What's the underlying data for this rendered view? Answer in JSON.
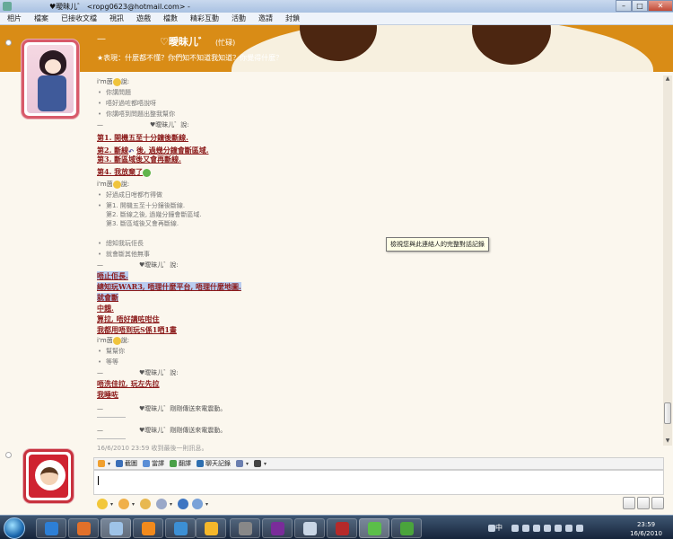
{
  "window": {
    "title": "♥曖昧儿゛ <ropg0623@hotmail.com> - ",
    "controls": {
      "minimize": "–",
      "maximize": "□",
      "close": "✕"
    }
  },
  "menu": [
    "相片",
    "檔案",
    "已接收文檔",
    "視訊",
    "遊戲",
    "檔數",
    "精彩互動",
    "活動",
    "邀請",
    "封鎖"
  ],
  "contact": {
    "dash": "—",
    "name": "♡曖昧儿゛",
    "state": "(忙碌)",
    "personal_message": "★表現：什麼都不懂？你們知不知道我知道？你覺得什麼？"
  },
  "tooltip": "檢視您與此連絡人的完整對話記錄",
  "timestamp": "16/6/2010 23:59 收到最後一則訊息。",
  "conversation": [
    {
      "kind": "speaker",
      "text": "i'm茵",
      "suffix": "說:",
      "emo": "star"
    },
    {
      "kind": "line",
      "text": "你講問題"
    },
    {
      "kind": "line",
      "text": "唔好過咗都唔說呀"
    },
    {
      "kind": "line",
      "text": "你講唔到問題出整我幫你"
    },
    {
      "kind": "quote",
      "text": "♥曖昧儿゛說:"
    },
    {
      "kind": "red",
      "text": "第1. 開機五至十分鐘後斷線."
    },
    {
      "kind": "red",
      "text": "第2. 斷線",
      "emo": "hook",
      "suffix": "後, 過幾分鐘會斷區域."
    },
    {
      "kind": "red",
      "text": "第3. 斷區域後又會再斷線."
    },
    {
      "kind": "red",
      "text": "第4. 我放棄了",
      "emo": "green"
    },
    {
      "kind": "speaker",
      "text": "i'm茵",
      "suffix": "說:",
      "emo": "star"
    },
    {
      "kind": "line",
      "text": "好過成日咁都冇得做"
    },
    {
      "kind": "line",
      "text": "第1. 開機五至十分鐘後斷線."
    },
    {
      "kind": "plain",
      "text": "第2. 斷線之後, 過幾分鐘會斷區域."
    },
    {
      "kind": "plain",
      "text": "第3. 斷區域後又會再斷線."
    },
    {
      "kind": "line",
      "text": "總知我玩佢長"
    },
    {
      "kind": "line",
      "text": "就會斷其他無事"
    },
    {
      "kind": "quote",
      "text": "♥曖昧儿゛說:"
    },
    {
      "kind": "red-hl",
      "text": "唔止佢長."
    },
    {
      "kind": "red-hl",
      "text": "總知玩WAR3, 唔理什麼平台, 唔理什麼地圖."
    },
    {
      "kind": "red-hl",
      "text": "就會斷"
    },
    {
      "kind": "red",
      "text": "中餓."
    },
    {
      "kind": "red",
      "text": "算拉, 唔好講咗咁住"
    },
    {
      "kind": "red",
      "text": "我都用唔到玩S係1哂1晝"
    },
    {
      "kind": "speaker",
      "text": "i'm茵",
      "suffix": "說:",
      "emo": "star"
    },
    {
      "kind": "line",
      "text": "幫幫你"
    },
    {
      "kind": "line",
      "text": "等等"
    },
    {
      "kind": "quote",
      "text": "♥曖昧儿゛說:"
    },
    {
      "kind": "red",
      "text": "唔洗佳拉, 玩左先拉"
    },
    {
      "kind": "red",
      "text": "我睡咗"
    },
    {
      "kind": "nudge",
      "text": "♥曖昧儿゛剛剛傳送來電震動。"
    },
    {
      "kind": "nudge",
      "text": "♥曖昧儿゛剛剛傳送來電震動。"
    }
  ],
  "toolbar": {
    "items": [
      {
        "label": "",
        "icon": "font-icon"
      },
      {
        "label": "截圖",
        "icon": "screenshot-icon"
      },
      {
        "label": "當譯",
        "icon": "translate-icon"
      },
      {
        "label": "翻譯",
        "icon": "dictionary-icon"
      },
      {
        "label": "聊天記錄",
        "icon": "history-icon"
      },
      {
        "label": "",
        "icon": "games-icon"
      },
      {
        "label": "",
        "icon": "people-icon"
      }
    ]
  },
  "taskbar": {
    "lang": "中",
    "time": "23:59",
    "date": "16/6/2010"
  },
  "colors": {
    "banner": "#d98c16",
    "red_text": "#8b1a1a",
    "highlight": "#b9cdf0",
    "avatar_border": "#d85a6a"
  }
}
